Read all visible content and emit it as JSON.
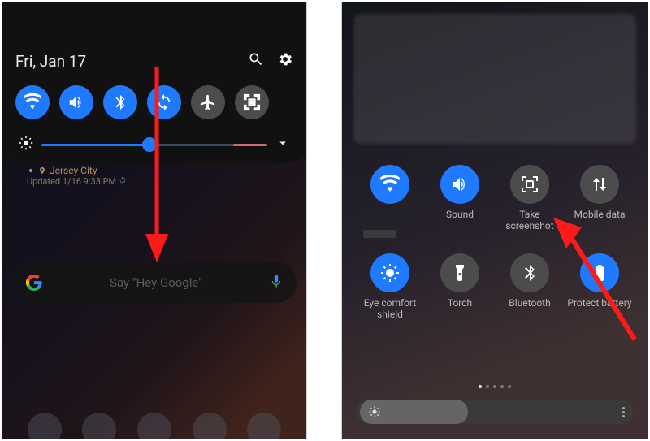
{
  "left": {
    "date": "Fri, Jan 17",
    "tiles": [
      {
        "name": "wifi",
        "on": true
      },
      {
        "name": "sound",
        "on": true
      },
      {
        "name": "bluetooth",
        "on": true
      },
      {
        "name": "auto-rotate",
        "on": true
      },
      {
        "name": "airplane",
        "on": false
      },
      {
        "name": "screenshot",
        "on": false
      }
    ],
    "brightness_percent": 48,
    "weather": {
      "location": "Jersey City",
      "updated": "Updated 1/16 9:33 PM"
    },
    "search_placeholder": "Say \"Hey Google\""
  },
  "right": {
    "tiles": [
      {
        "name": "wifi",
        "label": "",
        "on": true
      },
      {
        "name": "sound",
        "label": "Sound",
        "on": true
      },
      {
        "name": "screenshot",
        "label": "Take screenshot",
        "on": false
      },
      {
        "name": "mobile-data",
        "label": "Mobile data",
        "on": false
      },
      {
        "name": "eye-comfort",
        "label": "Eye comfort shield",
        "on": true
      },
      {
        "name": "torch",
        "label": "Torch",
        "on": false
      },
      {
        "name": "bluetooth",
        "label": "Bluetooth",
        "on": false
      },
      {
        "name": "protect-battery",
        "label": "Protect battery",
        "on": true
      }
    ],
    "page_dots": 5,
    "active_dot": 0,
    "brightness_percent": 40
  }
}
